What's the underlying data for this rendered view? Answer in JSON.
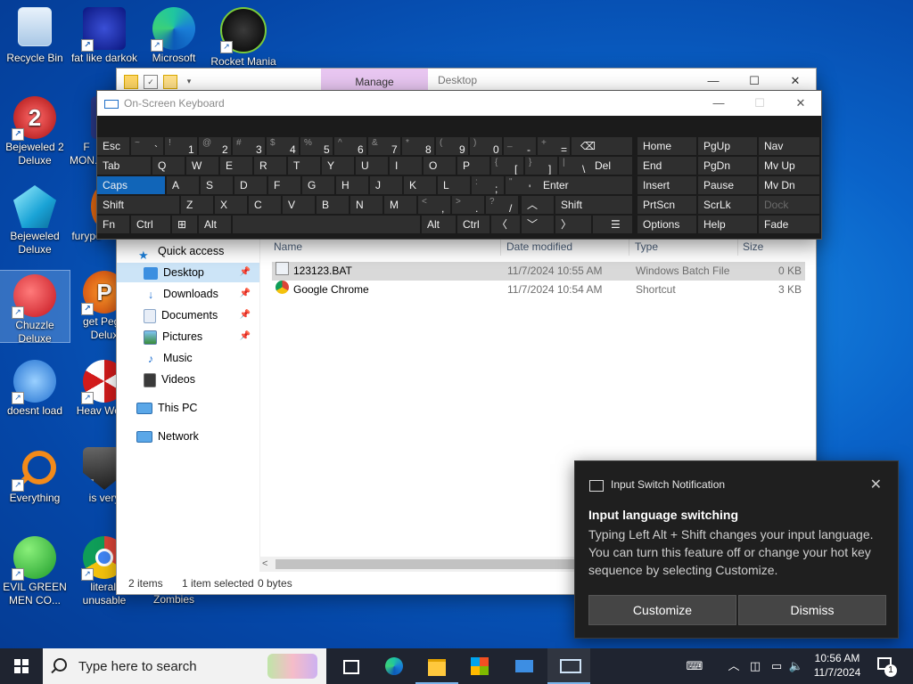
{
  "desktop": {
    "icons": [
      {
        "label": "Recycle Bin"
      },
      {
        "label": "fat like darkok"
      },
      {
        "label": "Microsoft"
      },
      {
        "label": "Rocket Mania"
      },
      {
        "label": "Bejeweled 2 Deluxe"
      },
      {
        "label": "F MON..."
      },
      {
        "label": "Bejeweled Deluxe"
      },
      {
        "label": "furypo"
      },
      {
        "label": "Chuzzle Deluxe"
      },
      {
        "label": "get Pegg Delux"
      },
      {
        "label": "doesnt load"
      },
      {
        "label": "Heav Weap"
      },
      {
        "label": "Everything"
      },
      {
        "label": "is very"
      },
      {
        "label": "EVIL GREEN MEN CO..."
      },
      {
        "label": "literall unusable"
      },
      {
        "label": "Zombies"
      }
    ]
  },
  "explorer": {
    "ribbon_tab": "Manage",
    "title": "Desktop",
    "columns": {
      "name": "Name",
      "date": "Date modified",
      "type": "Type",
      "size": "Size"
    },
    "nav": [
      {
        "label": "Quick access",
        "icon": "star-icon"
      },
      {
        "label": "Desktop",
        "icon": "desktop-folder-icon"
      },
      {
        "label": "Downloads",
        "icon": "downloads-icon"
      },
      {
        "label": "Documents",
        "icon": "documents-icon"
      },
      {
        "label": "Pictures",
        "icon": "pictures-icon"
      },
      {
        "label": "Music",
        "icon": "music-icon"
      },
      {
        "label": "Videos",
        "icon": "videos-icon"
      },
      {
        "label": "This PC",
        "icon": "pc-icon"
      },
      {
        "label": "Network",
        "icon": "network-icon"
      }
    ],
    "files": [
      {
        "name": "123123.BAT",
        "date": "11/7/2024 10:55 AM",
        "type": "Windows Batch File",
        "size": "0 KB"
      },
      {
        "name": "Google Chrome",
        "date": "11/7/2024 10:54 AM",
        "type": "Shortcut",
        "size": "3 KB"
      }
    ],
    "status": {
      "items": "2 items",
      "selected": "1 item selected",
      "bytes": "0 bytes"
    }
  },
  "osk": {
    "title": "On-Screen Keyboard",
    "keys": {
      "esc": "Esc",
      "tab": "Tab",
      "caps": "Caps",
      "shift": "Shift",
      "fn": "Fn",
      "ctrl": "Ctrl",
      "alt": "Alt",
      "del": "Del",
      "enter": "Enter",
      "rshift": "Shift",
      "ralt": "Alt",
      "rctrl": "Ctrl",
      "home": "Home",
      "pgup": "PgUp",
      "nav": "Nav",
      "end": "End",
      "pgdn": "PgDn",
      "mvup": "Mv Up",
      "insert": "Insert",
      "pause": "Pause",
      "mvdn": "Mv Dn",
      "prtscn": "PrtScn",
      "scrlk": "ScrLk",
      "dock": "Dock",
      "options": "Options",
      "help": "Help",
      "fade": "Fade"
    },
    "row1": [
      {
        "sup": "~",
        "main": "`"
      },
      {
        "sup": "!",
        "main": "1"
      },
      {
        "sup": "@",
        "main": "2"
      },
      {
        "sup": "#",
        "main": "3"
      },
      {
        "sup": "$",
        "main": "4"
      },
      {
        "sup": "%",
        "main": "5"
      },
      {
        "sup": "^",
        "main": "6"
      },
      {
        "sup": "&",
        "main": "7"
      },
      {
        "sup": "*",
        "main": "8"
      },
      {
        "sup": "(",
        "main": "9"
      },
      {
        "sup": ")",
        "main": "0"
      },
      {
        "sup": "_",
        "main": "-"
      },
      {
        "sup": "+",
        "main": "="
      }
    ],
    "row2": [
      "Q",
      "W",
      "E",
      "R",
      "T",
      "Y",
      "U",
      "I",
      "O",
      "P"
    ],
    "row2_sym": [
      {
        "sup": "{",
        "main": "["
      },
      {
        "sup": "}",
        "main": "]"
      },
      {
        "sup": "|",
        "main": "\\"
      }
    ],
    "row3": [
      "A",
      "S",
      "D",
      "F",
      "G",
      "H",
      "J",
      "K",
      "L"
    ],
    "row3_sym": [
      {
        "sup": ":",
        "main": ";"
      },
      {
        "sup": "\"",
        "main": "'"
      }
    ],
    "row4": [
      "Z",
      "X",
      "C",
      "V",
      "B",
      "N",
      "M"
    ],
    "row4_sym": [
      {
        "sup": "<",
        "main": ","
      },
      {
        "sup": ">",
        "main": "."
      },
      {
        "sup": "?",
        "main": "/"
      }
    ]
  },
  "toast": {
    "app": "Input Switch Notification",
    "heading": "Input language switching",
    "body": "Typing Left Alt + Shift changes your input language. You can turn this feature off or change your hot key sequence by selecting Customize.",
    "customize": "Customize",
    "dismiss": "Dismiss"
  },
  "taskbar": {
    "search_placeholder": "Type here to search",
    "time": "10:56 AM",
    "date": "11/7/2024",
    "notifications": "1"
  },
  "colors": {
    "accent": "#1165b8",
    "toast_bg": "#1f1f1f",
    "taskbar_bg": "#1f2430",
    "manage_tab": "#e8c6f1"
  }
}
